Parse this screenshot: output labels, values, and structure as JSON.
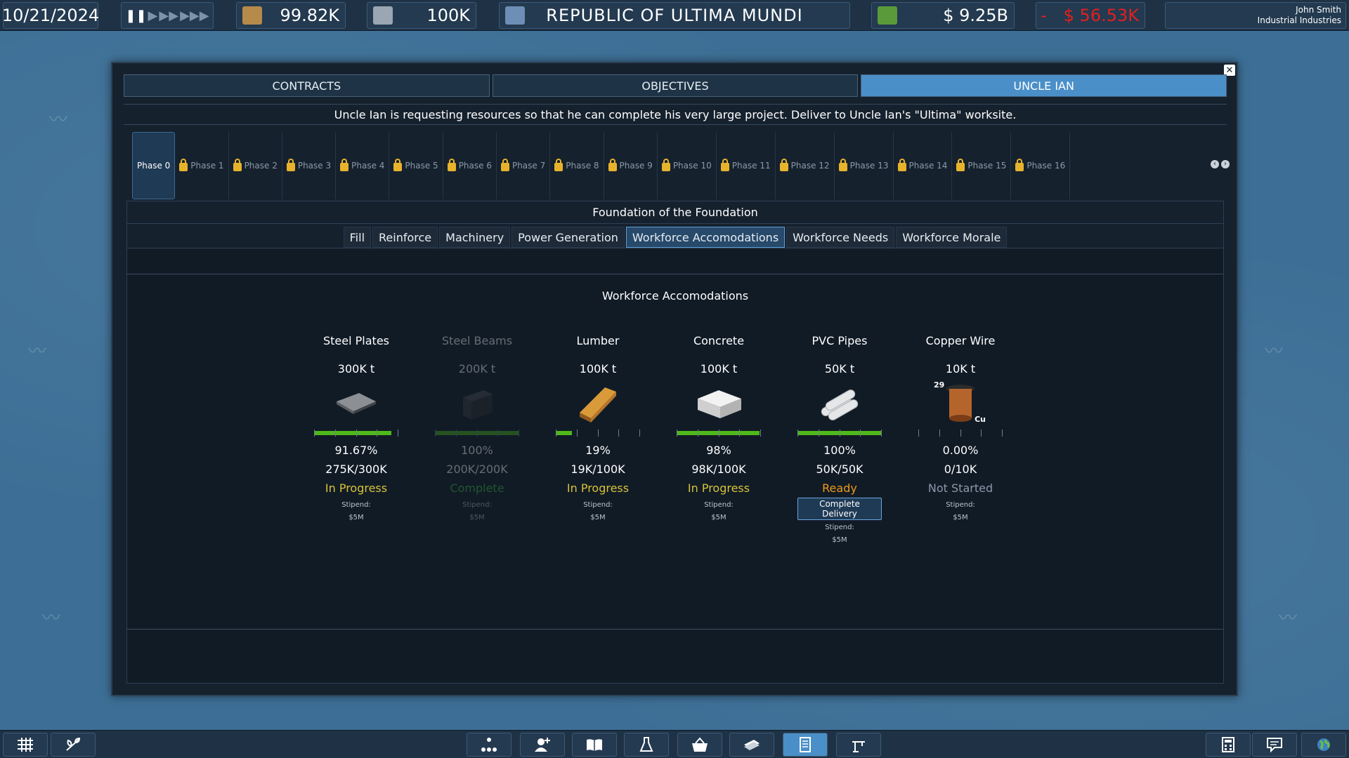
{
  "topbar": {
    "date": "10/21/2024",
    "resource1": "99.82K",
    "resource2": "100K",
    "nation": "REPUBLIC OF ULTIMA MUNDI",
    "money": "$ 9.25B",
    "delta_sign": "-",
    "delta": "$ 56.53K",
    "user_name": "John Smith",
    "company": "Industrial Industries",
    "colors": {
      "negative": "#e02020",
      "accent": "#4a8fc8"
    }
  },
  "tabs": [
    {
      "label": "CONTRACTS"
    },
    {
      "label": "OBJECTIVES"
    },
    {
      "label": "UNCLE IAN"
    }
  ],
  "request_text": "Uncle Ian is requesting resources so that he can complete his very large project. Deliver to Uncle Ian's \"Ultima\" worksite.",
  "phases": [
    "Phase 0",
    "Phase 1",
    "Phase 2",
    "Phase 3",
    "Phase 4",
    "Phase 5",
    "Phase 6",
    "Phase 7",
    "Phase 8",
    "Phase 9",
    "Phase 10",
    "Phase 11",
    "Phase 12",
    "Phase 13",
    "Phase 14",
    "Phase 15",
    "Phase 16"
  ],
  "section_title": "Foundation of the Foundation",
  "subtabs": [
    "Fill",
    "Reinforce",
    "Machinery",
    "Power Generation",
    "Workforce Accomodations",
    "Workforce Needs",
    "Workforce Morale"
  ],
  "inner_title": "Workforce Accomodations",
  "stipend_label": "Stipend:",
  "items": [
    {
      "name": "Steel Plates",
      "amount": "300K t",
      "pct": "91.67%",
      "progress": 0.9167,
      "qty": "275K/300K",
      "status": "In Progress",
      "stipend": "$5M"
    },
    {
      "name": "Steel Beams",
      "amount": "200K t",
      "pct": "100%",
      "progress": 1.0,
      "qty": "200K/200K",
      "status": "Complete",
      "stipend": "$5M"
    },
    {
      "name": "Lumber",
      "amount": "100K t",
      "pct": "19%",
      "progress": 0.19,
      "qty": "19K/100K",
      "status": "In Progress",
      "stipend": "$5M"
    },
    {
      "name": "Concrete",
      "amount": "100K t",
      "pct": "98%",
      "progress": 0.98,
      "qty": "98K/100K",
      "status": "In Progress",
      "stipend": "$5M"
    },
    {
      "name": "PVC Pipes",
      "amount": "50K t",
      "pct": "100%",
      "progress": 1.0,
      "qty": "50K/50K",
      "status": "Ready",
      "stipend": "$5M",
      "button": "Complete Delivery"
    },
    {
      "name": "Copper Wire",
      "amount": "10K t",
      "pct": "0.00%",
      "progress": 0.0,
      "qty": "0/10K",
      "status": "Not Started",
      "stipend": "$5M",
      "icon_text": [
        "29",
        "Cu"
      ]
    }
  ],
  "bottombar_icons": [
    "grid-icon",
    "farm-icon",
    "hierarchy-icon",
    "add-person-icon",
    "book-icon",
    "flask-icon",
    "basket-icon",
    "cash-icon",
    "contract-icon",
    "crane-icon",
    "calculator-icon",
    "chat-icon",
    "globe-icon"
  ]
}
